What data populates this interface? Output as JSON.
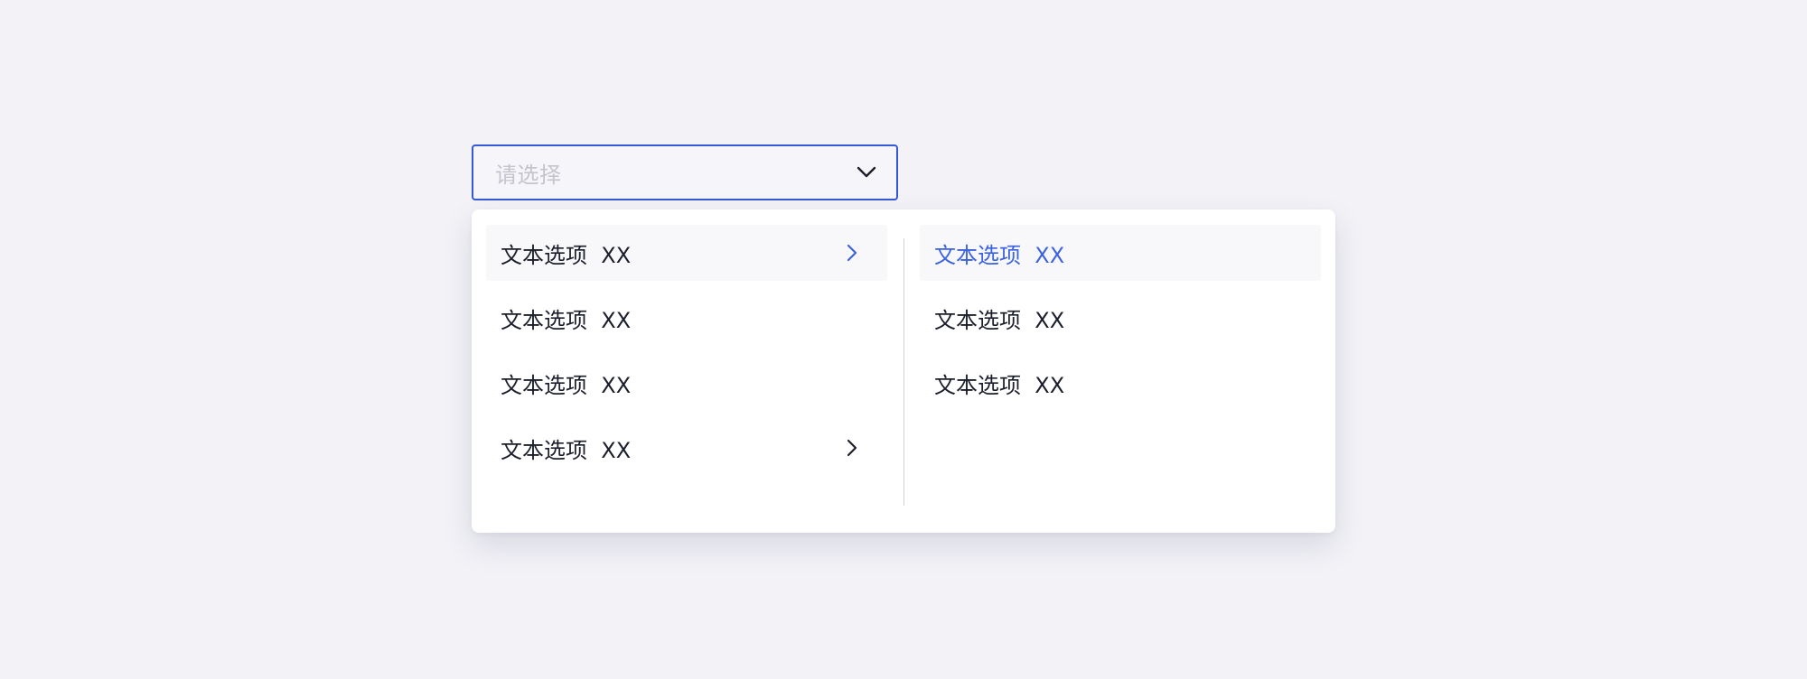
{
  "select": {
    "placeholder": "请选择",
    "icon": "chevron-down-icon"
  },
  "colors": {
    "accent": "#3459d8",
    "selected_text": "#3b62e0",
    "text": "#1c1f2b",
    "placeholder": "#c4c4cc",
    "background": "#f2f2f7"
  },
  "cascader": {
    "level1": [
      {
        "label": "文本选项  XX",
        "has_children": true,
        "state": "active"
      },
      {
        "label": "文本选项  XX",
        "has_children": false,
        "state": "normal"
      },
      {
        "label": "文本选项  XX",
        "has_children": false,
        "state": "normal"
      },
      {
        "label": "文本选项  XX",
        "has_children": true,
        "state": "normal"
      }
    ],
    "level2": [
      {
        "label": "文本选项  XX",
        "state": "selected"
      },
      {
        "label": "文本选项  XX",
        "state": "normal"
      },
      {
        "label": "文本选项  XX",
        "state": "normal"
      }
    ]
  }
}
